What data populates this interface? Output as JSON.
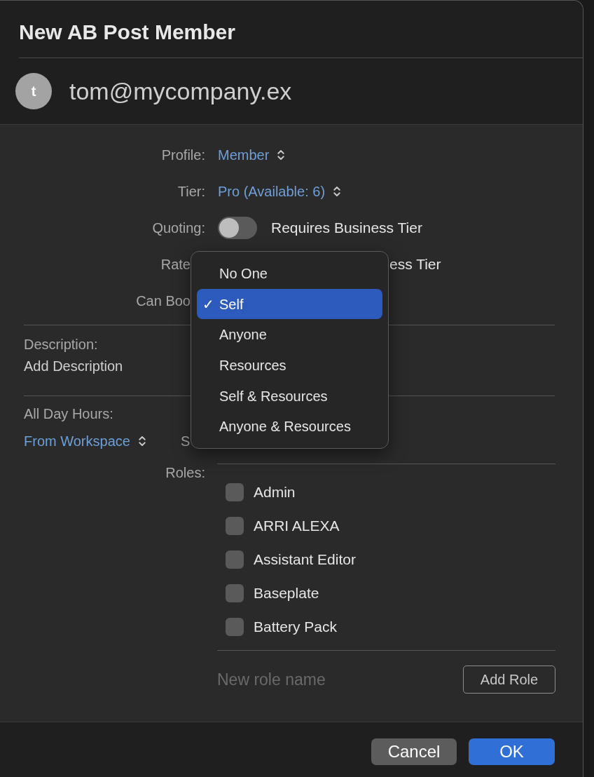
{
  "dialog": {
    "title": "New AB Post Member",
    "avatar_initial": "t",
    "email": "tom@mycompany.ex"
  },
  "fields": [
    {
      "kind": "popup",
      "label": "Profile:",
      "value": "Member"
    },
    {
      "kind": "popup",
      "label": "Tier:",
      "value": "Pro (Available: 6)"
    },
    {
      "kind": "toggle",
      "label": "Quoting:",
      "on": false,
      "note": "Requires Business Tier"
    },
    {
      "kind": "partial",
      "label": "Rate",
      "note": "ess Tier"
    },
    {
      "kind": "partial",
      "label": "Can Boo"
    }
  ],
  "description": {
    "label": "Description:",
    "placeholder": "Add Description"
  },
  "hours": {
    "label": "All Day Hours:",
    "value": "From Workspace",
    "column_2": "S"
  },
  "roles": {
    "label": "Roles:",
    "items": [
      {
        "label": "Admin",
        "checked": false
      },
      {
        "label": "ARRI ALEXA",
        "checked": false
      },
      {
        "label": "Assistant Editor",
        "checked": false
      },
      {
        "label": "Baseplate",
        "checked": false
      },
      {
        "label": "Battery Pack",
        "checked": false
      }
    ],
    "new_role": {
      "placeholder": "New role name"
    },
    "add_button": "Add Role"
  },
  "menu": {
    "check": "✓",
    "items": [
      {
        "label": "No One",
        "selected": false
      },
      {
        "label": "Self",
        "selected": true
      },
      {
        "label": "Anyone",
        "selected": false
      },
      {
        "label": "Resources",
        "selected": false
      },
      {
        "label": "Self & Resources",
        "selected": false
      },
      {
        "label": "Anyone & Resources",
        "selected": false
      }
    ]
  },
  "buttons": [
    {
      "label": "Cancel",
      "kind": "secondary"
    },
    {
      "label": "OK",
      "kind": "primary"
    }
  ]
}
